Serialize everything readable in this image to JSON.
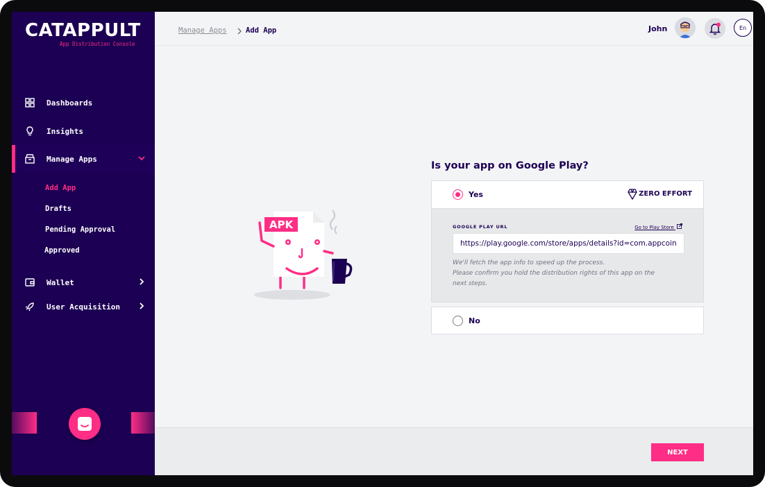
{
  "brand": {
    "name": "CATAPPULT",
    "subtitle": "App Distribution Console"
  },
  "colors": {
    "sidebar_bg": "#1c0053",
    "accent": "#fe2d85",
    "text_dark": "#1c0053",
    "page_bg": "#f3f4f6"
  },
  "sidebar": {
    "items": [
      {
        "label": "Dashboards",
        "icon": "grid-icon"
      },
      {
        "label": "Insights",
        "icon": "lightbulb-icon"
      },
      {
        "label": "Manage Apps",
        "icon": "inbox-icon",
        "expanded": true
      },
      {
        "label": "Wallet",
        "icon": "wallet-icon"
      },
      {
        "label": "User Acquisition",
        "icon": "rocket-icon"
      }
    ],
    "subitems": [
      {
        "label": "Add App",
        "current": true
      },
      {
        "label": "Drafts"
      },
      {
        "label": "Pending Approval"
      },
      {
        "label": "Approved"
      }
    ]
  },
  "header": {
    "breadcrumb_parent": "Manage Apps",
    "breadcrumb_current": "Add App",
    "user_name": "John",
    "language": "En"
  },
  "illustration": {
    "badge": "APK"
  },
  "form": {
    "question": "Is your app on Google Play?",
    "option_yes": "Yes",
    "option_yes_tag": "ZERO EFFORT",
    "option_no": "No",
    "selected": "Yes",
    "url_label": "GOOGLE PLAY URL",
    "play_store_link": "Go to Play Store",
    "url_value": "https://play.google.com/store/apps/details?id=com.appcoins.",
    "note_line1": "We'll fetch the app info to speed up the process.",
    "note_line2": "Please confirm you hold the distribution rights of this app on the",
    "note_line3": "next steps."
  },
  "footer": {
    "next_label": "NEXT"
  }
}
